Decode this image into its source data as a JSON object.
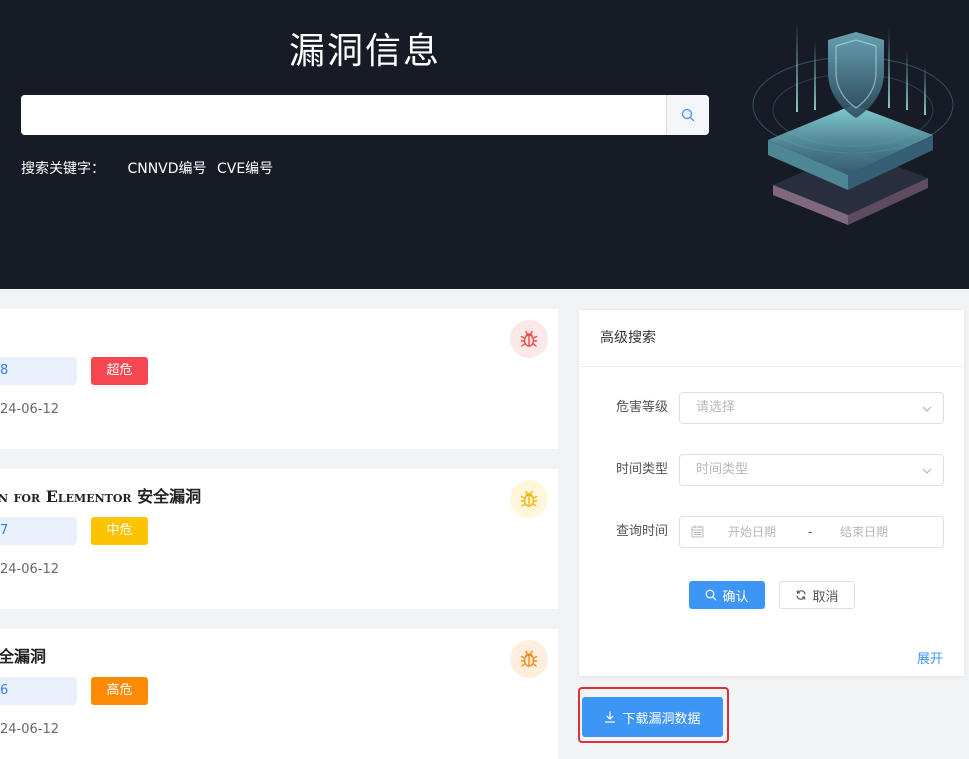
{
  "hero": {
    "title": "漏洞信息",
    "search_placeholder": "",
    "keywords_label": "搜索关键字：",
    "keywords": [
      "CNNVD编号",
      "CVE编号"
    ]
  },
  "vulnerabilities": [
    {
      "title": "",
      "id_fragment": "8",
      "level": "超危",
      "level_color": "#f5474f",
      "date": "24-06-12",
      "badge_bg": "#fde8e8",
      "badge_color": "#ef4b4b",
      "icon": "bug-icon"
    },
    {
      "title": "n for Elementor 安全漏洞",
      "id_fragment": "7",
      "level": "中危",
      "level_color": "#fcc300",
      "date": "24-06-12",
      "badge_bg": "#fff6dc",
      "badge_color": "#f3b500",
      "icon": "bug-icon"
    },
    {
      "title": "全漏洞",
      "id_fragment": "6",
      "level": "高危",
      "level_color": "#fb8b04",
      "date": "24-06-12",
      "badge_bg": "#fdeedd",
      "badge_color": "#f38a1a",
      "icon": "bug-icon"
    }
  ],
  "advanced_search": {
    "title": "高级搜索",
    "fields": {
      "severity_label": "危害等级",
      "severity_placeholder": "请选择",
      "time_type_label": "时间类型",
      "time_type_placeholder": "时间类型",
      "query_time_label": "查询时间",
      "start_placeholder": "开始日期",
      "separator": "-",
      "end_placeholder": "结束日期"
    },
    "confirm_label": "确认",
    "cancel_label": "取消",
    "expand_label": "展开"
  },
  "download_label": "下载漏洞数据",
  "colors": {
    "accent": "#3d95f5",
    "hero_bg": "#171b26",
    "highlight_frame": "#e0303a"
  }
}
